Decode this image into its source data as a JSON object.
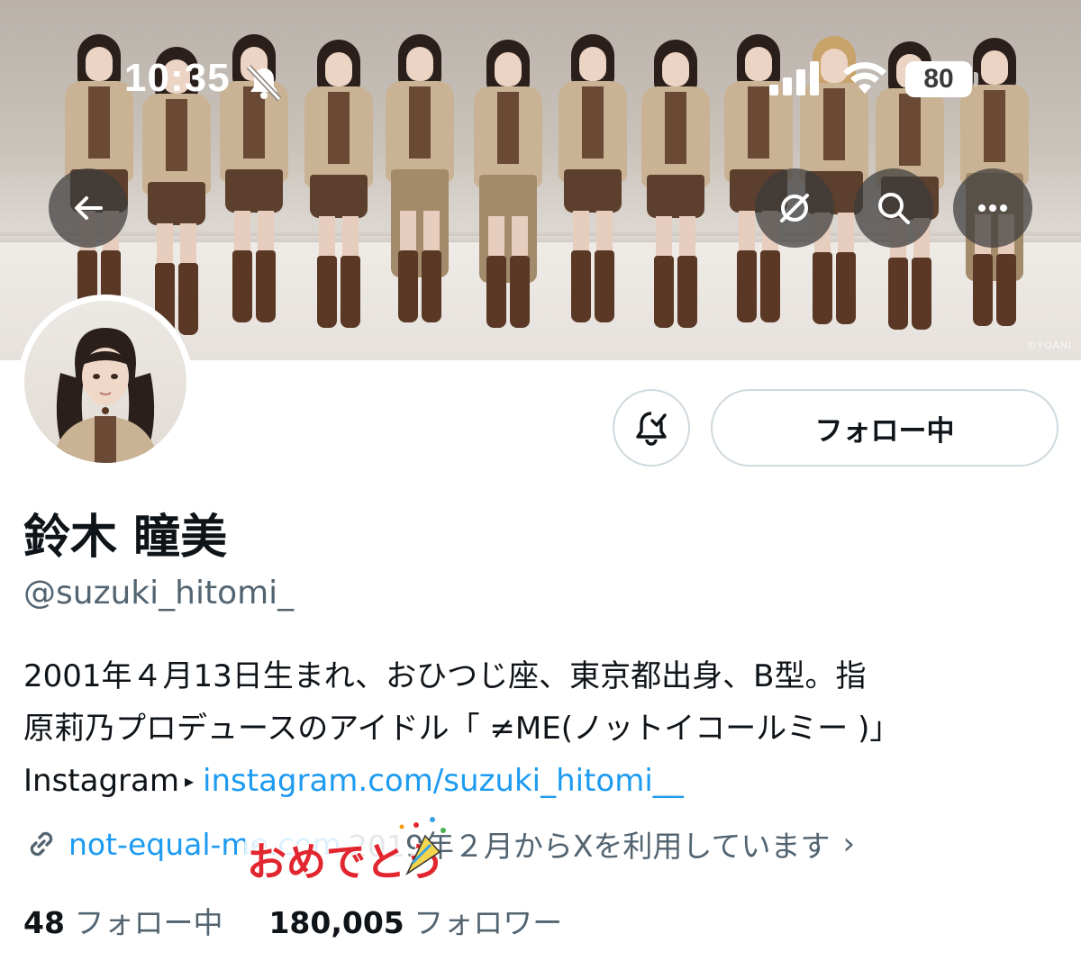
{
  "status_bar": {
    "time": "10:35",
    "battery": "80",
    "icons": [
      "bell-slash-icon",
      "cellular-signal-icon",
      "wifi-icon",
      "battery-icon"
    ]
  },
  "banner": {
    "credit": "©YOANI"
  },
  "nav": {
    "icons": [
      "back-arrow-icon",
      "grok-icon",
      "search-icon",
      "more-icon"
    ]
  },
  "actions": {
    "follow_label": "フォロー中",
    "bell_icon": "bell-check-icon"
  },
  "profile": {
    "name": "鈴木 瞳美",
    "handle": "@suzuki_hitomi_",
    "bio_line1": "2001年４月13日生まれ、おひつじ座、東京都出身、B型。指",
    "bio_line2": "原莉乃プロデュースのアイドル「 ≠ME(ノットイコールミー )」",
    "bio_line3_label": "Instagram",
    "bio_line3_link": "instagram.com/suzuki_hitomi__",
    "website": "not-equal-me.com",
    "joined": "2019年２月からXを利用しています",
    "sticker_text": "おめでとう"
  },
  "counts": {
    "following_num": "48",
    "following_label": "フォロー中",
    "followers_num": "180,005",
    "followers_label": "フォロワー"
  },
  "colors": {
    "link": "#1d9bf0",
    "secondary_text": "#536471",
    "primary_text": "#0f1419",
    "border": "#cfd9de"
  }
}
